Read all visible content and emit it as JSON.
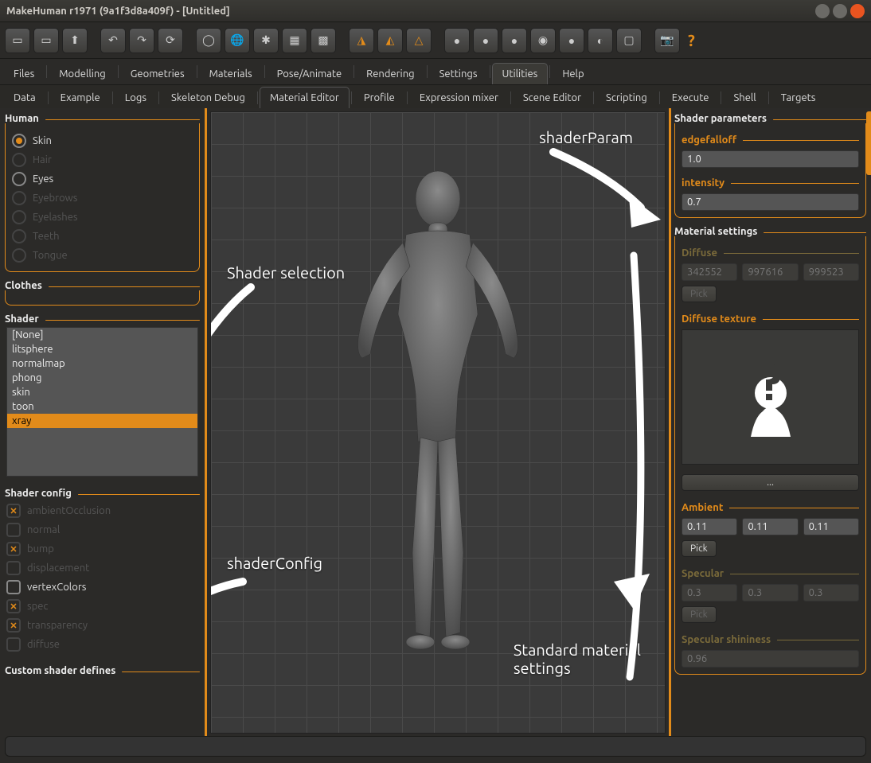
{
  "window": {
    "title": "MakeHuman r1971 (9a1f3d8a409f) - [Untitled]"
  },
  "main_tabs": [
    "Files",
    "Modelling",
    "Geometries",
    "Materials",
    "Pose/Animate",
    "Rendering",
    "Settings",
    "Utilities",
    "Help"
  ],
  "main_tab_active": "Utilities",
  "sub_tabs": [
    "Data",
    "Example",
    "Logs",
    "Skeleton Debug",
    "Material Editor",
    "Profile",
    "Expression mixer",
    "Scene Editor",
    "Scripting",
    "Execute",
    "Shell",
    "Targets"
  ],
  "sub_tab_active": "Material Editor",
  "human": {
    "title": "Human",
    "options": [
      {
        "label": "Skin",
        "type": "radio",
        "checked": true,
        "enabled": true
      },
      {
        "label": "Hair",
        "type": "radio",
        "checked": false,
        "enabled": false
      },
      {
        "label": "Eyes",
        "type": "radio",
        "checked": false,
        "enabled": true
      },
      {
        "label": "Eyebrows",
        "type": "radio",
        "checked": false,
        "enabled": false
      },
      {
        "label": "Eyelashes",
        "type": "radio",
        "checked": false,
        "enabled": false
      },
      {
        "label": "Teeth",
        "type": "radio",
        "checked": false,
        "enabled": false
      },
      {
        "label": "Tongue",
        "type": "radio",
        "checked": false,
        "enabled": false
      }
    ]
  },
  "clothes": {
    "title": "Clothes"
  },
  "shader": {
    "title": "Shader",
    "items": [
      "[None]",
      "litsphere",
      "normalmap",
      "phong",
      "skin",
      "toon",
      "xray"
    ],
    "selected": "xray"
  },
  "shader_config": {
    "title": "Shader config",
    "items": [
      {
        "label": "ambientOcclusion",
        "state": "x",
        "dim": true
      },
      {
        "label": "normal",
        "state": "empty",
        "dim": true
      },
      {
        "label": "bump",
        "state": "x",
        "dim": true
      },
      {
        "label": "displacement",
        "state": "empty",
        "dim": true
      },
      {
        "label": "vertexColors",
        "state": "empty",
        "dim": false
      },
      {
        "label": "spec",
        "state": "x",
        "dim": true
      },
      {
        "label": "transparency",
        "state": "x",
        "dim": true
      },
      {
        "label": "diffuse",
        "state": "empty",
        "dim": true
      }
    ]
  },
  "custom_defines": {
    "title": "Custom shader defines"
  },
  "shader_params": {
    "title": "Shader parameters",
    "edgefalloff": {
      "label": "edgefalloff",
      "value": "1.0"
    },
    "intensity": {
      "label": "intensity",
      "value": "0.7"
    }
  },
  "material_settings": {
    "title": "Material settings",
    "diffuse": {
      "label": "Diffuse",
      "values": [
        "342552",
        "997616",
        "999523"
      ],
      "pick": "Pick",
      "dim": true
    },
    "diffuse_texture": {
      "label": "Diffuse texture",
      "browse": "..."
    },
    "ambient": {
      "label": "Ambient",
      "values": [
        "0.11",
        "0.11",
        "0.11"
      ],
      "pick": "Pick",
      "dim": false
    },
    "specular": {
      "label": "Specular",
      "values": [
        "0.3",
        "0.3",
        "0.3"
      ],
      "pick": "Pick",
      "dim": true
    },
    "specular_shininess": {
      "label": "Specular shininess",
      "value": "0.96",
      "dim": true
    }
  },
  "annotations": {
    "shader_selection": "Shader selection",
    "shader_config": "shaderConfig",
    "shader_param": "shaderParam",
    "std_material": "Standard material\nsettings"
  }
}
